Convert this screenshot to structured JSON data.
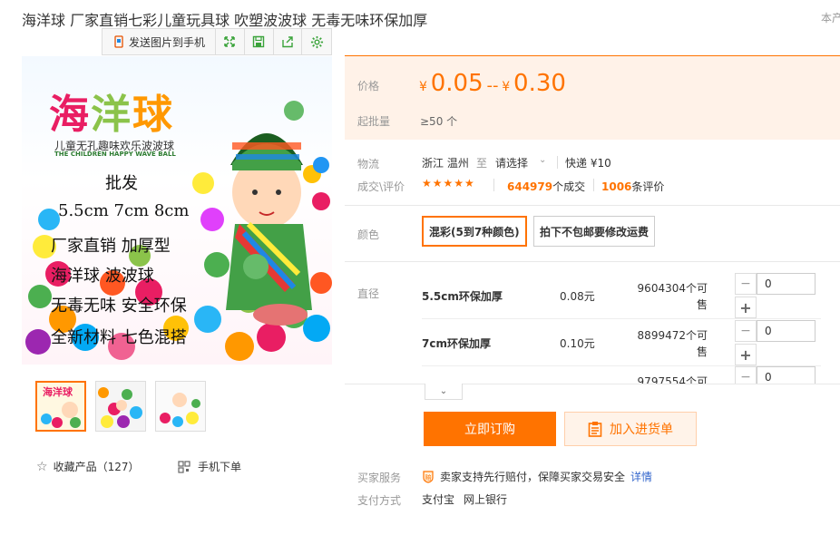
{
  "title": "海洋球 厂家直销七彩儿童玩具球 吹塑波波球 无毒无味环保加厚",
  "corner_text": "本产",
  "toolbar": {
    "send_label": "发送图片到手机",
    "icons": [
      "expand-icon",
      "save-icon",
      "share-icon",
      "settings-icon"
    ]
  },
  "image": {
    "title_chars": [
      "海",
      "洋",
      "球"
    ],
    "subtitle": "儿童无孔趣味欢乐波波球",
    "subtitle_en": "THE CHILDREN HAPPY WAVE BALL",
    "lines": [
      "批发",
      "5.5cm   7cm   8cm",
      "厂家直销   加厚型",
      "海洋球     波波球",
      "无毒无味   安全环保",
      "全新材料   七色混搭"
    ]
  },
  "favorite": {
    "label": "收藏产品（127）"
  },
  "mobile": {
    "label": "手机下单"
  },
  "price": {
    "label": "价格",
    "currency": "¥",
    "low": "0.05",
    "sep": "--",
    "high": "0.30",
    "moq_label": "起批量",
    "moq_value": "≥50 个"
  },
  "logistics": {
    "label": "物流",
    "from": "浙江 温州",
    "to_word": "至",
    "select": "请选择",
    "express": "快递 ¥10"
  },
  "deals": {
    "label": "成交\\评价",
    "stars": "★★★★★",
    "count": "644979",
    "count_suffix": "个成交",
    "reviews": "1006",
    "reviews_suffix": "条评价"
  },
  "color": {
    "label": "颜色",
    "options": [
      "混彩(5到7种颜色)",
      "拍下不包邮要修改运费"
    ]
  },
  "spec": {
    "label": "直径",
    "rows": [
      {
        "name": "5.5cm环保加厚",
        "price": "0.08元",
        "stock": "9604304个可售",
        "qty": "0"
      },
      {
        "name": "7cm环保加厚",
        "price": "0.10元",
        "stock": "8899472个可售",
        "qty": "0"
      },
      {
        "name": "",
        "price": "",
        "stock": "9797554个可",
        "qty": "0"
      }
    ]
  },
  "actions": {
    "buy": "立即订购",
    "cart": "加入进货单"
  },
  "service": {
    "label": "买家服务",
    "text": "卖家支持先行赔付，保障买家交易安全",
    "link": "详情"
  },
  "payment": {
    "label": "支付方式",
    "methods": [
      "支付宝",
      "网上银行"
    ]
  }
}
